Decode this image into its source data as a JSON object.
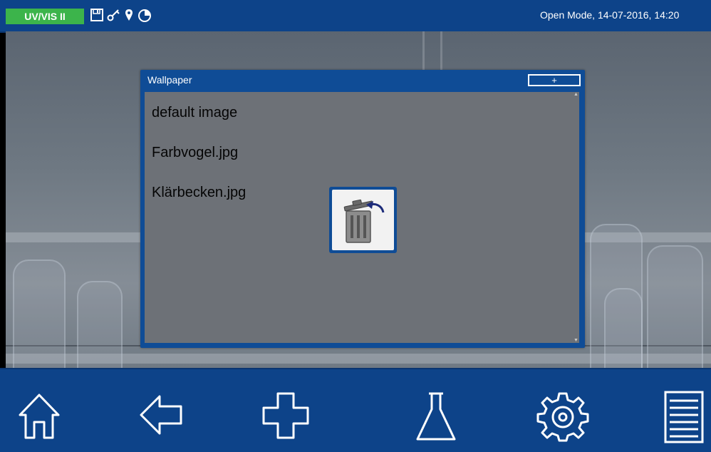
{
  "topbar": {
    "product_label": "UV/VIS II",
    "status_text": "Open Mode, 14-07-2016, 14:20",
    "icons": [
      "save-icon",
      "key-icon",
      "location-pin-icon",
      "timer-icon"
    ]
  },
  "dialog": {
    "title": "Wallpaper",
    "add_button_label": "+",
    "items": [
      {
        "label": "default image"
      },
      {
        "label": "Farbvogel.jpg"
      },
      {
        "label": "Klärbecken.jpg"
      }
    ],
    "delete_icon": "trash-icon"
  },
  "bottom_nav": {
    "buttons": [
      "home-icon",
      "back-arrow-icon",
      "plus-icon",
      "flask-icon",
      "gear-icon",
      "menu-list-icon"
    ]
  },
  "colors": {
    "bar_blue": "#0d4389",
    "badge_green": "#3cb44b",
    "dialog_body": "#6d7177"
  }
}
